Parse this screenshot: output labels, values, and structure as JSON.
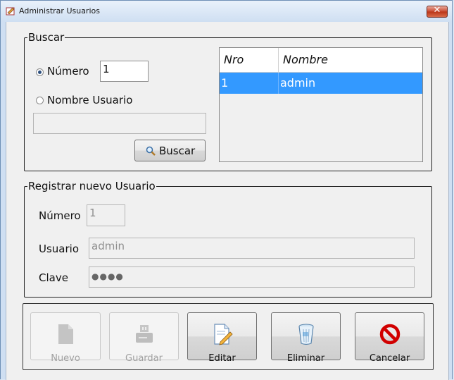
{
  "window": {
    "title": "Administrar Usuarios"
  },
  "search": {
    "legend": "Buscar",
    "radio_numero": "Número",
    "numero_value": "1",
    "radio_nombre": "Nombre Usuario",
    "nombre_value": "",
    "button": "Buscar"
  },
  "grid": {
    "columns": [
      "Nro",
      "Nombre"
    ],
    "rows": [
      {
        "nro": "1",
        "nombre": "admin"
      }
    ]
  },
  "register": {
    "legend": "Registrar nuevo Usuario",
    "numero_label": "Número",
    "numero_value": "1",
    "usuario_label": "Usuario",
    "usuario_value": "admin",
    "clave_label": "Clave",
    "clave_value": "●●●●"
  },
  "actions": {
    "nuevo": "Nuevo",
    "guardar": "Guardar",
    "editar": "Editar",
    "eliminar": "Eliminar",
    "cancelar": "Cancelar"
  },
  "colors": {
    "selection": "#3399ff",
    "accent_cancel": "#d10000"
  }
}
